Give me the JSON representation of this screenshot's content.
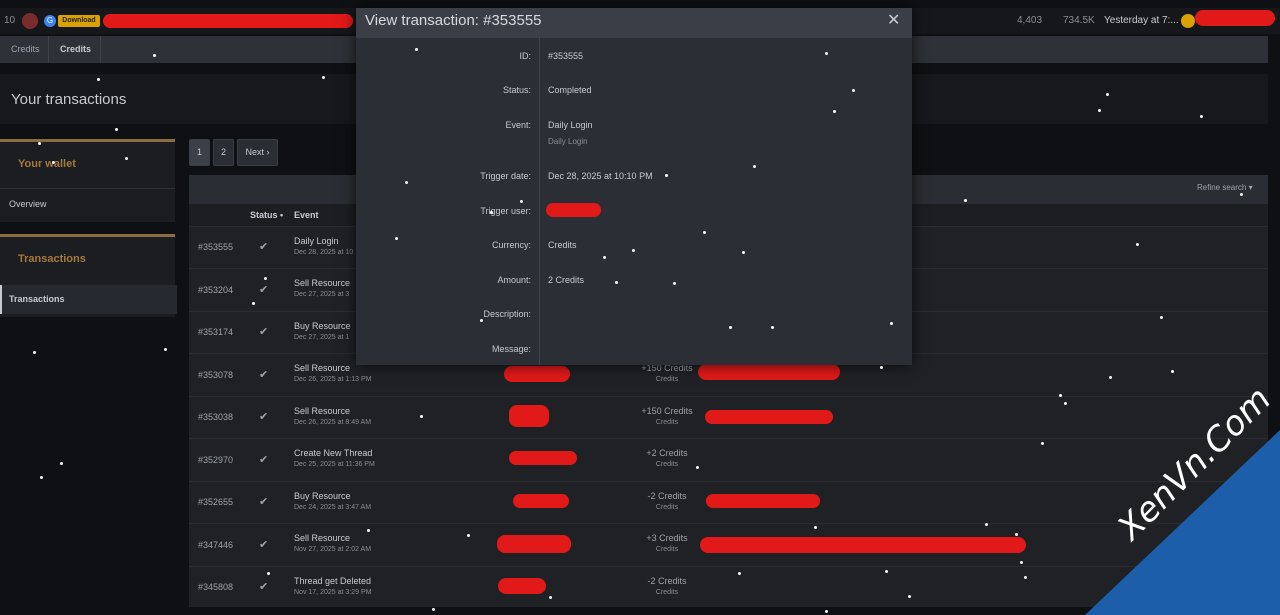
{
  "topbar": {
    "version": "10",
    "g_label": "G",
    "download_label": "Download",
    "stat1": "4,403",
    "stat2": "734.5K",
    "time": "Yesterday at 7:..."
  },
  "breadcrumbs": [
    "Credits",
    "Credits"
  ],
  "page_title": "Your transactions",
  "sidebar": {
    "wallet_heading": "Your wallet",
    "wallet_link": "Overview",
    "transactions_heading": "Transactions",
    "transactions_link": "Transactions"
  },
  "pagination": {
    "page1": "1",
    "page2": "2",
    "next": "Next ›"
  },
  "filter": {
    "refine": "Refine search ▾"
  },
  "table": {
    "headers": {
      "status": "Status •",
      "event": "Event"
    },
    "rows": [
      {
        "id": "#353555",
        "check": "✔",
        "event": "Daily Login",
        "date": "Dec 28, 2025 at 10:10 PM",
        "amount": "",
        "unit": ""
      },
      {
        "id": "#353204",
        "check": "✔",
        "event": "Sell Resource",
        "date": "Dec 27, 2025 at 3",
        "amount": "",
        "unit": ""
      },
      {
        "id": "#353174",
        "check": "✔",
        "event": "Buy Resource",
        "date": "Dec 27, 2025 at 1",
        "amount": "",
        "unit": ""
      },
      {
        "id": "#353078",
        "check": "✔",
        "event": "Sell Resource",
        "date": "Dec 26, 2025 at 1:13 PM",
        "amount": "+150 Credits",
        "unit": "Credits"
      },
      {
        "id": "#353038",
        "check": "✔",
        "event": "Sell Resource",
        "date": "Dec 26, 2025 at 8:49 AM",
        "amount": "+150 Credits",
        "unit": "Credits"
      },
      {
        "id": "#352970",
        "check": "✔",
        "event": "Create New Thread",
        "date": "Dec 25, 2025 at 11:36 PM",
        "amount": "+2 Credits",
        "unit": "Credits"
      },
      {
        "id": "#352655",
        "check": "✔",
        "event": "Buy Resource",
        "date": "Dec 24, 2025 at 3:47 AM",
        "amount": "-2 Credits",
        "unit": "Credits"
      },
      {
        "id": "#347446",
        "check": "✔",
        "event": "Sell Resource",
        "date": "Nov 27, 2025 at 2:02 AM",
        "amount": "+3 Credits",
        "unit": "Credits"
      },
      {
        "id": "#345808",
        "check": "✔",
        "event": "Thread get Deleted",
        "date": "Nov 17, 2025 at 3:29 PM",
        "amount": "-2 Credits",
        "unit": "Credits"
      }
    ]
  },
  "modal": {
    "title": "View transaction: #353555",
    "close": "✕",
    "labels": {
      "id": "ID:",
      "status": "Status:",
      "event": "Event:",
      "trigger_date": "Trigger date:",
      "trigger_user": "Trigger user:",
      "currency": "Currency:",
      "amount": "Amount:",
      "description": "Description:",
      "message": "Message:"
    },
    "values": {
      "id": "#353555",
      "status": "Completed",
      "event": "Daily Login",
      "event_sub": "Daily Login",
      "trigger_date": "Dec 28, 2025 at 10:10 PM",
      "currency": "Credits",
      "amount": "2 Credits"
    }
  },
  "watermark": "XenVn.Com",
  "colors": {
    "accent": "#a7783a",
    "redaction": "#e11919",
    "watermark_blue": "#1c5eaa"
  }
}
